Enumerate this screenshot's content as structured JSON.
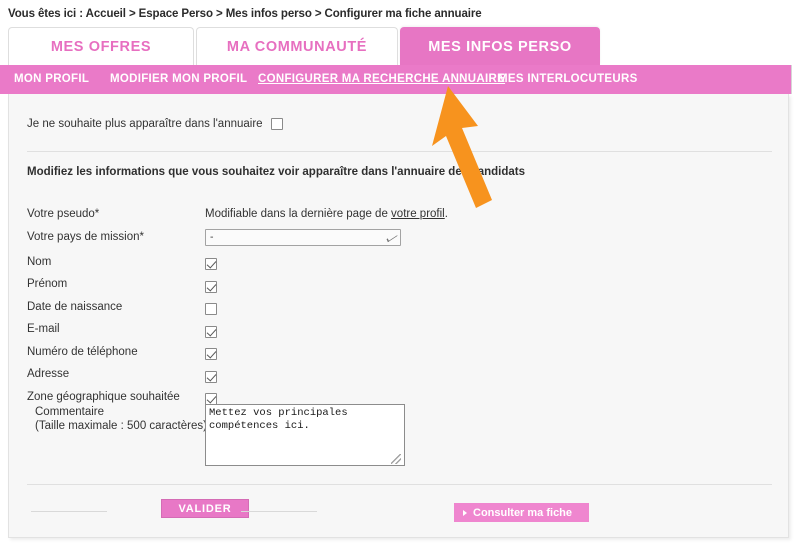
{
  "breadcrumb": {
    "text": "Vous êtes ici : Accueil > Espace Perso > Mes infos perso > Configurer ma fiche annuaire"
  },
  "tabs": [
    {
      "label": "MES OFFRES",
      "active": false
    },
    {
      "label": "MA COMMUNAUTÉ",
      "active": false
    },
    {
      "label": "MES INFOS PERSO",
      "active": true
    }
  ],
  "subnav": [
    {
      "label": "MON PROFIL",
      "current": false
    },
    {
      "label": "MODIFIER MON PROFIL",
      "current": false
    },
    {
      "label": "CONFIGURER MA RECHERCHE ANNUAIRE",
      "current": true
    },
    {
      "label": "MES INTERLOCUTEURS",
      "current": false
    }
  ],
  "form": {
    "optout_label": "Je ne souhaite plus apparaître dans l'annuaire",
    "optout_checked": false,
    "intro": "Modifiez les informations que vous souhaitez voir apparaître dans l'annuaire des candidats",
    "pseudo": {
      "label": "Votre pseudo*",
      "hint_prefix": "Modifiable dans la dernière page de ",
      "hint_link": "votre profil",
      "hint_suffix": "."
    },
    "country": {
      "label": "Votre pays de mission*",
      "selected": "-"
    },
    "fields": [
      {
        "label": "Nom",
        "checked": true
      },
      {
        "label": "Prénom",
        "checked": true
      },
      {
        "label": "Date de naissance",
        "checked": false
      },
      {
        "label": "E-mail",
        "checked": true
      },
      {
        "label": "Numéro de téléphone",
        "checked": true
      },
      {
        "label": "Adresse",
        "checked": true
      },
      {
        "label": "Zone géographique souhaitée",
        "checked": true
      }
    ],
    "comment": {
      "label_line1": "Commentaire",
      "label_line2": "(Taille maximale : 500 caractères)",
      "value": "Mettez vos principales compétences ici."
    }
  },
  "footer": {
    "validate_label": "VALIDER",
    "consult_label": "Consulter ma fiche"
  },
  "annotation": {
    "arrow_color": "#f7931e",
    "points_to": "CONFIGURER MA RECHERCHE ANNUAIRE"
  },
  "colors": {
    "accent_pink": "#e776c4",
    "subnav_pink": "#ea7ac8",
    "panel_bg": "#f7f7f7",
    "arrow_orange": "#f7931e"
  }
}
